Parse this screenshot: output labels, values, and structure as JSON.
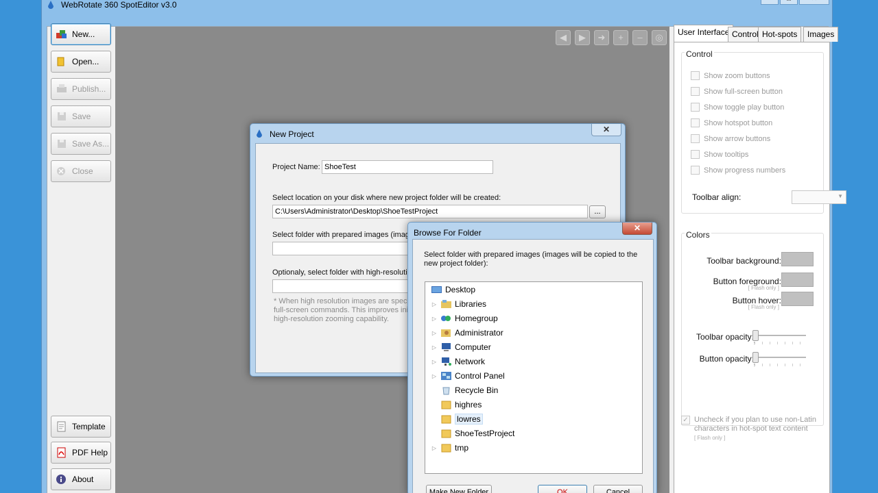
{
  "app": {
    "title": "WebRotate 360 SpotEditor v3.0",
    "controls": {
      "minimize": "–",
      "maximize": "□",
      "close": "✕"
    }
  },
  "sidebar": {
    "buttons": [
      {
        "label": "New...",
        "icon": "new-project-icon",
        "enabled": true
      },
      {
        "label": "Open...",
        "icon": "open-folder-icon",
        "enabled": true
      },
      {
        "label": "Publish...",
        "icon": "publish-icon",
        "enabled": false
      },
      {
        "label": "Save",
        "icon": "save-icon",
        "enabled": false
      },
      {
        "label": "Save As...",
        "icon": "save-as-icon",
        "enabled": false
      },
      {
        "label": "Close",
        "icon": "close-circle-icon",
        "enabled": false
      }
    ],
    "bottom_buttons": [
      {
        "label": "Template",
        "icon": "template-icon"
      },
      {
        "label": "PDF Help",
        "icon": "pdf-icon"
      },
      {
        "label": "About",
        "icon": "info-icon"
      }
    ]
  },
  "canvas_toolbar": [
    "arrow-left-icon",
    "play-icon",
    "arrow-right-icon",
    "zoom-in-icon",
    "zoom-out-icon",
    "reset-icon"
  ],
  "tabs": [
    "User Interface",
    "Control",
    "Hot-spots",
    "Images"
  ],
  "ui_panel": {
    "control_group": {
      "title": "Control",
      "checkboxes": [
        "Show zoom buttons",
        "Show full-screen button",
        "Show toggle play button",
        "Show hotspot button",
        "Show arrow buttons",
        "Show tooltips",
        "Show progress numbers"
      ],
      "toolbar_align_label": "Toolbar align:",
      "toolbar_align_value": ""
    },
    "colors_group": {
      "title": "Colors",
      "toolbar_background": "Toolbar background:",
      "button_foreground": "Button foreground:",
      "button_foreground_note": "[ Flash only ]",
      "button_hover": "Button hover:",
      "button_hover_note": "[ Flash only ]",
      "swatch_color": "#c0c0c0",
      "toolbar_opacity": "Toolbar opacity:",
      "button_opacity": "Button opacity:"
    },
    "latin_option": {
      "label_line1": "Uncheck if you plan to use non-Latin",
      "label_line2": "characters in hot-spot text content",
      "note": "[ Flash only ]"
    }
  },
  "new_project": {
    "title": "New Project",
    "close": "✕",
    "project_name_label": "Project Name:",
    "project_name_value": "ShoeTest",
    "location_label": "Select location on your disk where new project folder will be created:",
    "location_value": "C:\\Users\\Administrator\\Desktop\\ShoeTestProject",
    "browse_label": "...",
    "images_label": "Select folder with prepared images (images",
    "highres_label": "Optionaly, select folder with high-resolution",
    "note_line1": "* When high resolution images are specifie",
    "note_line2": "full-screen commands. This improves initia",
    "note_line3": "high-resolution zooming capability."
  },
  "browse_dialog": {
    "title": "Browse For Folder",
    "close": "✕",
    "instruction_line1": "Select folder with prepared images (images will be copied to the",
    "instruction_line2": "new project folder):",
    "tree": [
      {
        "label": "Desktop",
        "icon": "desktop-icon",
        "expandable": false,
        "indent": 0
      },
      {
        "label": "Libraries",
        "icon": "libraries-icon",
        "expandable": true,
        "indent": 1
      },
      {
        "label": "Homegroup",
        "icon": "homegroup-icon",
        "expandable": true,
        "indent": 1
      },
      {
        "label": "Administrator",
        "icon": "user-folder-icon",
        "expandable": true,
        "indent": 1
      },
      {
        "label": "Computer",
        "icon": "computer-icon",
        "expandable": true,
        "indent": 1
      },
      {
        "label": "Network",
        "icon": "network-icon",
        "expandable": true,
        "indent": 1
      },
      {
        "label": "Control Panel",
        "icon": "control-panel-icon",
        "expandable": true,
        "indent": 1
      },
      {
        "label": "Recycle Bin",
        "icon": "recycle-bin-icon",
        "expandable": false,
        "indent": 1
      },
      {
        "label": "highres",
        "icon": "folder-icon",
        "expandable": false,
        "indent": 1
      },
      {
        "label": "lowres",
        "icon": "folder-icon",
        "expandable": false,
        "indent": 1,
        "selected": true
      },
      {
        "label": "ShoeTestProject",
        "icon": "folder-icon",
        "expandable": false,
        "indent": 1
      },
      {
        "label": "tmp",
        "icon": "folder-icon",
        "expandable": true,
        "indent": 1
      }
    ],
    "make_new_folder": "Make New Folder",
    "ok": "OK",
    "cancel": "Cancel"
  }
}
